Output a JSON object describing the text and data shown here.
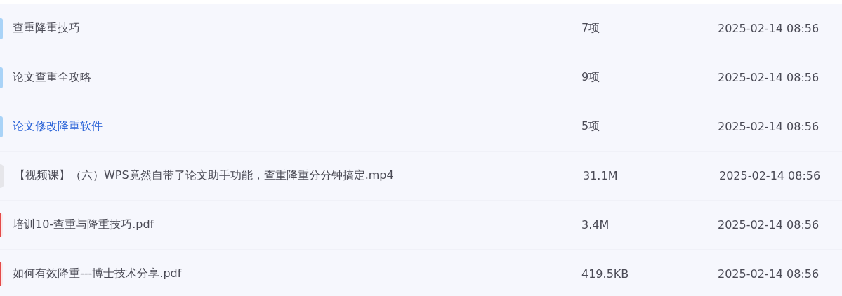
{
  "files": [
    {
      "kind": "folder",
      "name": "查重降重技巧",
      "size": "7项",
      "modified": "2025-02-14 08:56",
      "selected": false
    },
    {
      "kind": "folder",
      "name": "论文查重全攻略",
      "size": "9项",
      "modified": "2025-02-14 08:56",
      "selected": false
    },
    {
      "kind": "folder",
      "name": "论文修改降重软件",
      "size": "5项",
      "modified": "2025-02-14 08:56",
      "selected": true
    },
    {
      "kind": "video",
      "name": "【视频课】（六）WPS竟然自带了论文助手功能，查重降重分分钟搞定.mp4",
      "size": "31.1M",
      "modified": "2025-02-14 08:56",
      "selected": false
    },
    {
      "kind": "pdf",
      "name": "培训10-查重与降重技巧.pdf",
      "size": "3.4M",
      "modified": "2025-02-14 08:56",
      "selected": false
    },
    {
      "kind": "pdf",
      "name": "如何有效降重---博士技术分享.pdf",
      "size": "419.5KB",
      "modified": "2025-02-14 08:56",
      "selected": false
    }
  ]
}
